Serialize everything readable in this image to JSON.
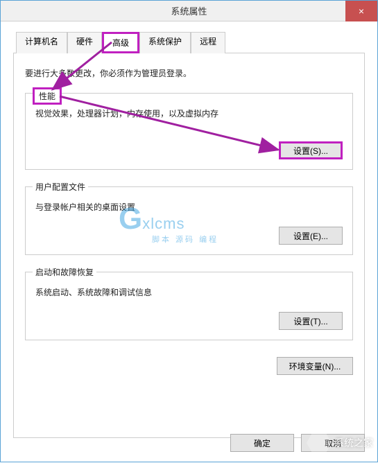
{
  "window": {
    "title": "系统属性",
    "close_glyph": "×"
  },
  "tabs": {
    "items": [
      {
        "label": "计算机名",
        "name": "tab-computer-name"
      },
      {
        "label": "硬件",
        "name": "tab-hardware"
      },
      {
        "label": "高级",
        "name": "tab-advanced"
      },
      {
        "label": "系统保护",
        "name": "tab-protection"
      },
      {
        "label": "远程",
        "name": "tab-remote"
      }
    ],
    "active_index": 2
  },
  "intro_text": "要进行大多数更改，你必须作为管理员登录。",
  "sections": {
    "performance": {
      "title": "性能",
      "desc": "视觉效果，处理器计划，内存使用，以及虚拟内存",
      "button": "设置(S)..."
    },
    "user_profiles": {
      "title": "用户配置文件",
      "desc": "与登录帐户相关的桌面设置",
      "button": "设置(E)..."
    },
    "startup_recovery": {
      "title": "启动和故障恢复",
      "desc": "系统启动、系统故障和调试信息",
      "button": "设置(T)..."
    }
  },
  "env_button": "环境变量(N)...",
  "buttons": {
    "ok": "确定",
    "cancel": "取消"
  },
  "watermark": {
    "brand_g": "G",
    "brand_text": "xlcms",
    "sub": "脚本 源码 编程"
  },
  "sys_logo_text": "系统之家",
  "highlights": {
    "tab_advanced": true,
    "performance_title": true,
    "performance_button": true
  },
  "arrow_color": "#a020a0"
}
